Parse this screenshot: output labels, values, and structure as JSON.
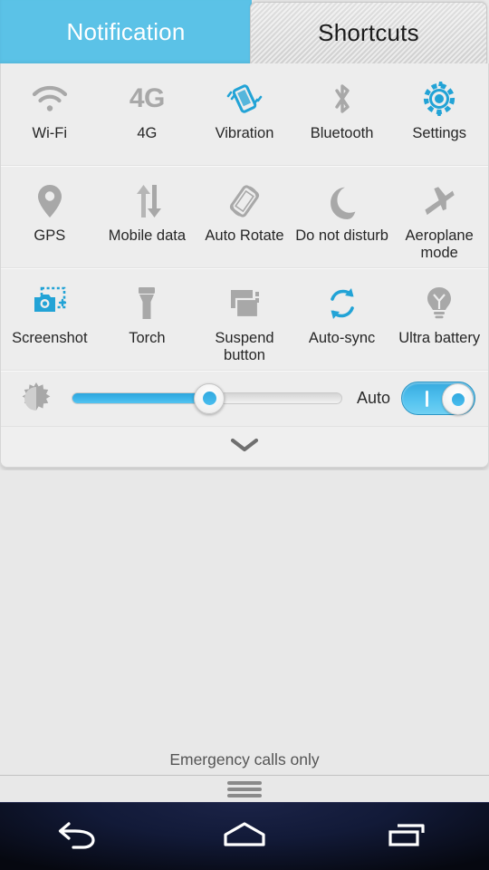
{
  "tabs": [
    {
      "label": "Notification",
      "active": false,
      "name": "tab-notification"
    },
    {
      "label": "Shortcuts",
      "active": true,
      "name": "tab-shortcuts"
    }
  ],
  "colors": {
    "accent_blue": "#5bc2e7",
    "active_icon_blue": "#22a3d6",
    "inactive_icon_gray": "#a8a8a8",
    "panel_bg": "#ededed",
    "label_text": "#262626",
    "navbar_bg": "#0b1228"
  },
  "tiles": [
    [
      {
        "label": "Wi-Fi",
        "icon": "wifi-icon",
        "active": false
      },
      {
        "label": "4G",
        "icon": "4g-icon",
        "active": false
      },
      {
        "label": "Vibration",
        "icon": "vibration-icon",
        "active": true
      },
      {
        "label": "Bluetooth",
        "icon": "bluetooth-icon",
        "active": false
      },
      {
        "label": "Settings",
        "icon": "gear-icon",
        "active": true
      }
    ],
    [
      {
        "label": "GPS",
        "icon": "location-pin-icon",
        "active": false
      },
      {
        "label": "Mobile data",
        "icon": "data-arrows-icon",
        "active": false
      },
      {
        "label": "Auto Rotate",
        "icon": "auto-rotate-icon",
        "active": false
      },
      {
        "label": "Do not disturb",
        "icon": "moon-icon",
        "active": false
      },
      {
        "label": "Aeroplane mode",
        "icon": "airplane-icon",
        "active": false
      }
    ],
    [
      {
        "label": "Screenshot",
        "icon": "screenshot-camera-icon",
        "active": true
      },
      {
        "label": "Torch",
        "icon": "flashlight-icon",
        "active": false
      },
      {
        "label": "Suspend button",
        "icon": "suspend-windows-icon",
        "active": false
      },
      {
        "label": "Auto-sync",
        "icon": "sync-arrows-icon",
        "active": true
      },
      {
        "label": "Ultra battery",
        "icon": "lightbulb-icon",
        "active": false
      }
    ]
  ],
  "brightness": {
    "icon": "brightness-sun-icon",
    "value_percent": 51,
    "auto_label": "Auto",
    "auto_enabled": true
  },
  "expand": {
    "icon": "chevron-down-icon"
  },
  "status": {
    "emergency_text": "Emergency calls only"
  },
  "navbar": [
    {
      "name": "nav-back-button",
      "icon": "back-arrow-icon"
    },
    {
      "name": "nav-home-button",
      "icon": "home-icon"
    },
    {
      "name": "nav-recents-button",
      "icon": "recents-icon"
    }
  ]
}
